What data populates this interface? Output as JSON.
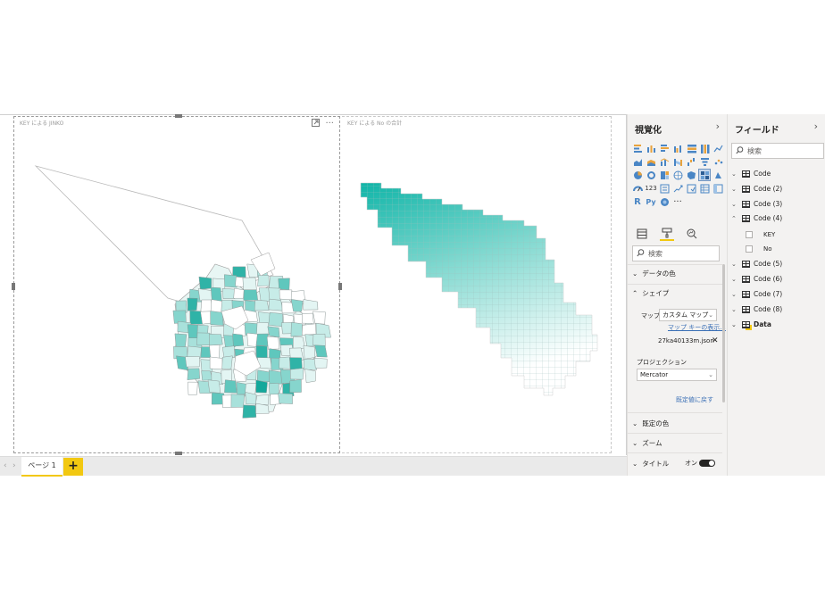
{
  "canvas": {
    "visuals": [
      {
        "title": "KEY による JINKO"
      },
      {
        "title": "KEY による No の合計"
      }
    ]
  },
  "page_tabs": {
    "items": [
      "ページ 1"
    ],
    "add_label": "+"
  },
  "visualizations": {
    "title": "視覚化",
    "search_placeholder": "検索",
    "sections": {
      "data_colors": "データの色",
      "shape": "シェイプ",
      "default_colors": "既定の色",
      "zoom": "ズーム",
      "title": "タイトル"
    },
    "shape": {
      "map_label": "マップ",
      "map_value": "カスタム マップ",
      "view_keys_link": "マップ キーの表示...",
      "file_name": "27ka40133m.json",
      "projection_label": "プロジェクション",
      "projection_value": "Mercator",
      "reset_link": "既定値に戻す"
    },
    "title_toggle": "オン"
  },
  "fields": {
    "title": "フィールド",
    "search_placeholder": "検索",
    "tables": [
      {
        "name": "Code",
        "expanded": false
      },
      {
        "name": "Code (2)",
        "expanded": false
      },
      {
        "name": "Code (3)",
        "expanded": false
      },
      {
        "name": "Code (4)",
        "expanded": true,
        "columns": [
          "KEY",
          "No"
        ]
      },
      {
        "name": "Code (5)",
        "expanded": false
      },
      {
        "name": "Code (6)",
        "expanded": false
      },
      {
        "name": "Code (7)",
        "expanded": false
      },
      {
        "name": "Code (8)",
        "expanded": false
      },
      {
        "name": "Data",
        "expanded": false
      }
    ]
  },
  "colors": {
    "accent": "#f2c811",
    "map_high": "#14b8a6",
    "map_low": "#ffffff"
  }
}
